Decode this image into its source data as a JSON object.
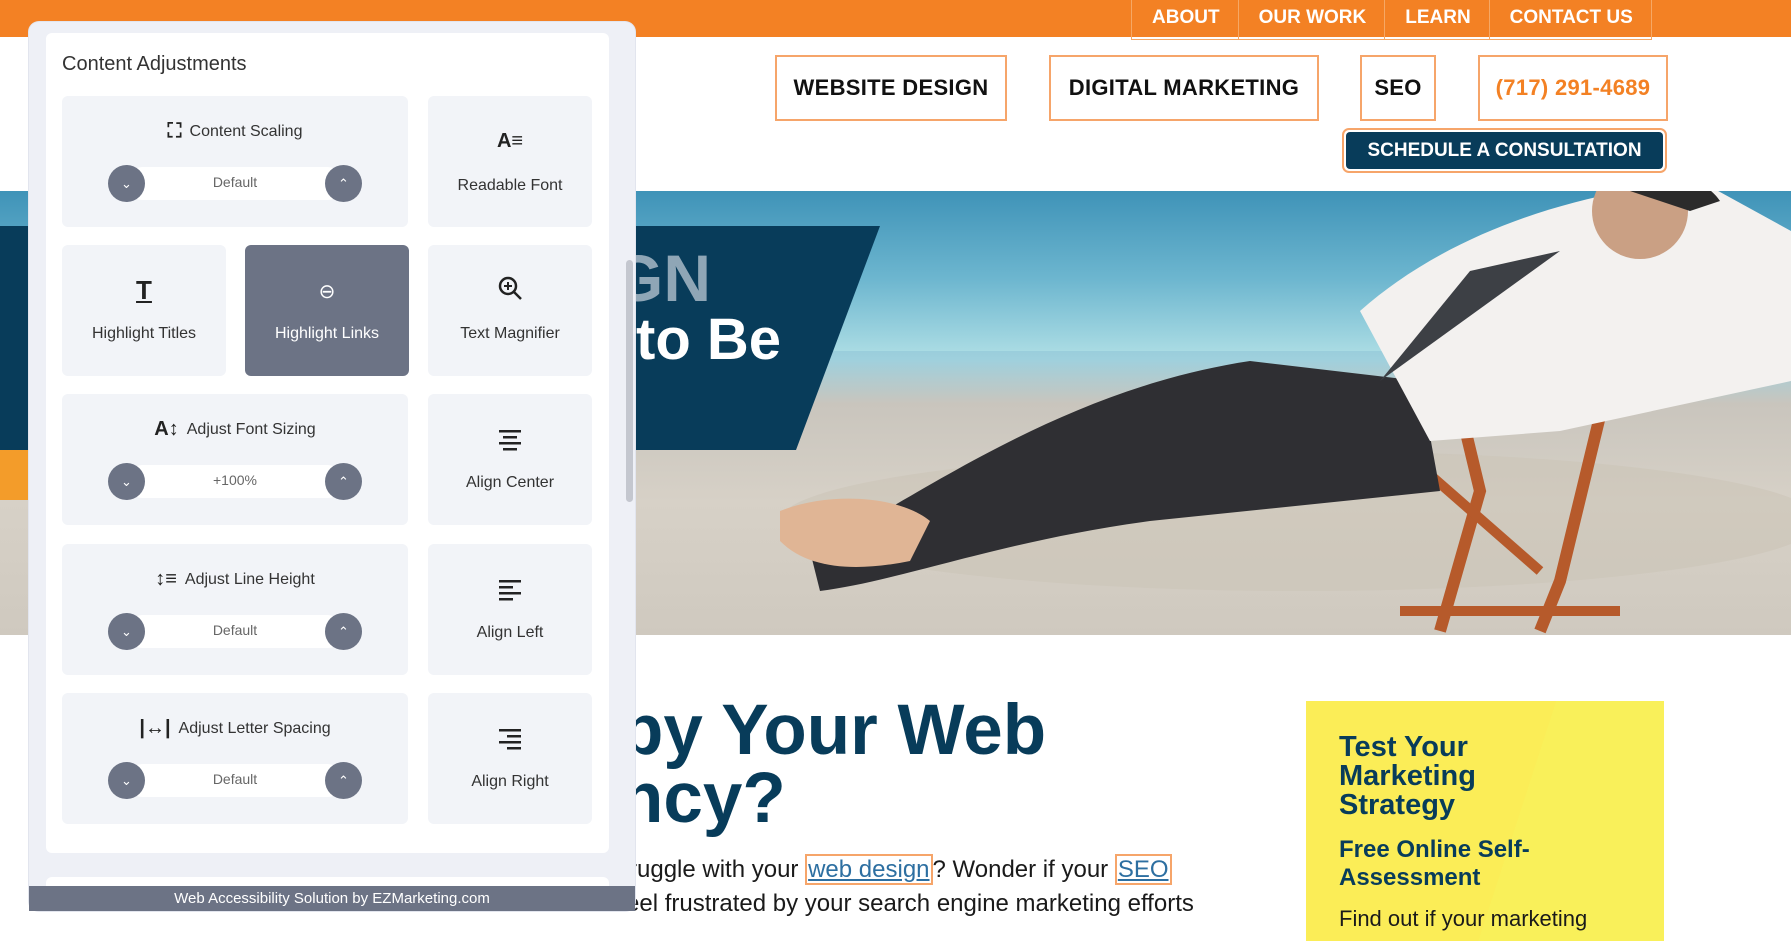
{
  "site": {
    "top_nav": [
      "ABOUT",
      "OUR WORK",
      "LEARN",
      "CONTACT US"
    ],
    "main_nav": [
      "WEBSITE DESIGN",
      "DIGITAL MARKETING",
      "SEO"
    ],
    "phone": "(717) 291-4689",
    "cta": "SCHEDULE A CONSULTATION",
    "hero_line1": "GN",
    "hero_line2": "to Be",
    "headline_line1": "py Your Web",
    "headline_line2": "ncy?",
    "body_1": "ruggle with your ",
    "link_web_design": "web design",
    "body_2": "? Wonder if your ",
    "link_seo": "SEO",
    "body_3": "eel frustrated by your search engine marketing efforts",
    "promo_title": "Test Your Marketing Strategy",
    "promo_sub": "Free Online Self-Assessment",
    "promo_text": "Find out if your marketing"
  },
  "panel": {
    "title": "Content Adjustments",
    "content_scaling": {
      "label": "Content Scaling",
      "value": "Default"
    },
    "readable_font": "Readable Font",
    "highlight_titles": "Highlight Titles",
    "highlight_links": "Highlight Links",
    "text_magnifier": "Text Magnifier",
    "font_sizing": {
      "label": "Adjust Font Sizing",
      "value": "+100%"
    },
    "align_center": "Align Center",
    "line_height": {
      "label": "Adjust Line Height",
      "value": "Default"
    },
    "align_left": "Align Left",
    "letter_spacing": {
      "label": "Adjust Letter Spacing",
      "value": "Default"
    },
    "align_right": "Align Right",
    "footer": "Web Accessibility Solution by EZMarketing.com"
  },
  "colors": {
    "orange": "#f38124",
    "navy": "#083c5a",
    "panel_active": "#6c7385",
    "promo": "#fbed57"
  },
  "icons": [
    "expand-icon",
    "readable-font-icon",
    "title-icon",
    "link-icon",
    "magnifier-icon",
    "font-size-icon",
    "align-center-icon",
    "line-height-icon",
    "align-left-icon",
    "letter-spacing-icon",
    "align-right-icon",
    "chevron-down-icon",
    "chevron-up-icon"
  ]
}
